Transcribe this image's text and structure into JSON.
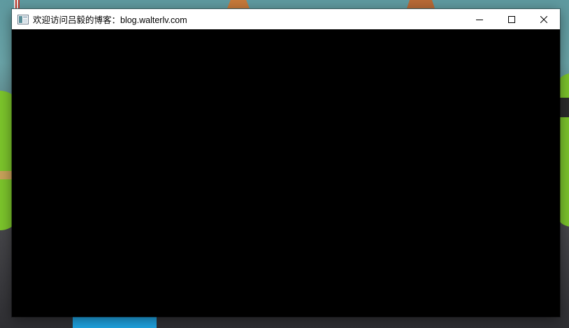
{
  "window": {
    "title": "欢迎访问吕毅的博客：blog.walterlv.com",
    "app_icon": "window-app-icon",
    "controls": {
      "minimize": "minimize-icon",
      "maximize": "maximize-icon",
      "close": "close-icon"
    },
    "client_background": "#000000",
    "titlebar_background": "#ffffff"
  }
}
